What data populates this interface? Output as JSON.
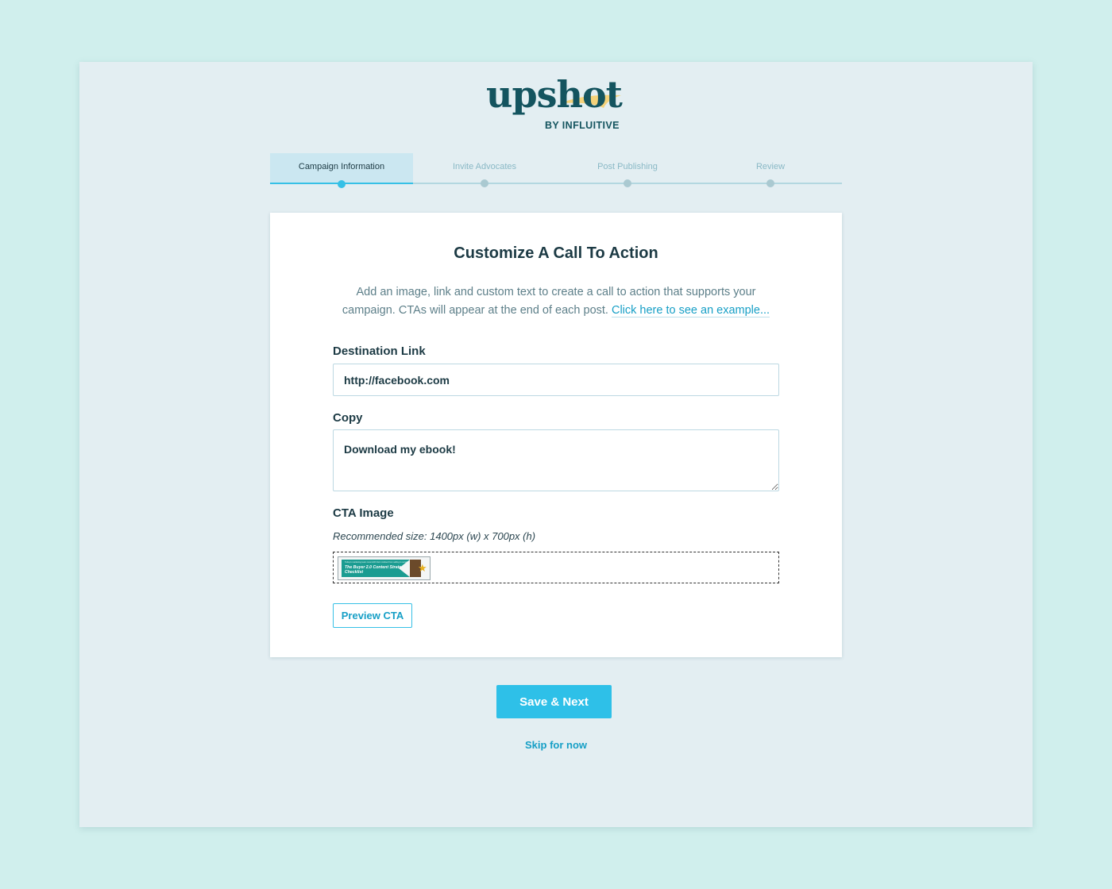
{
  "logo": {
    "wordmark": "upshot",
    "byline": "BY INFLUITIVE",
    "colors": {
      "word": "#14545f",
      "swoosh": "#f4d27a"
    }
  },
  "stepper": {
    "steps": [
      {
        "label": "Campaign Information",
        "active": true
      },
      {
        "label": "Invite Advocates",
        "active": false
      },
      {
        "label": "Post Publishing",
        "active": false
      },
      {
        "label": "Review",
        "active": false
      }
    ]
  },
  "card": {
    "title": "Customize A Call To Action",
    "description": "Add an image, link and custom text to create a call to action that supports your campaign. CTAs will appear at the end of each post.",
    "example_link": "Click here to see an example..."
  },
  "form": {
    "destination": {
      "label": "Destination Link",
      "value": "http://facebook.com"
    },
    "copy": {
      "label": "Copy",
      "value": "Download my ebook!"
    },
    "cta_image": {
      "label": "CTA Image",
      "recommended": "Recommended size: 1400px (w) x 700px (h)",
      "thumbnail": {
        "topline": "Today's marketing team must shift their mindset from selling to serving.",
        "title": "The Buyer 2.0 Content Strategy Checklist",
        "icon": "star-icon"
      }
    },
    "preview_button": "Preview CTA"
  },
  "actions": {
    "save_next": "Save & Next",
    "skip": "Skip for now"
  },
  "colors": {
    "page_bg": "#d0efed",
    "panel_bg": "#e3eef2",
    "accent": "#2ec0e8",
    "link": "#169fc6",
    "text_dark": "#1c3a44"
  }
}
